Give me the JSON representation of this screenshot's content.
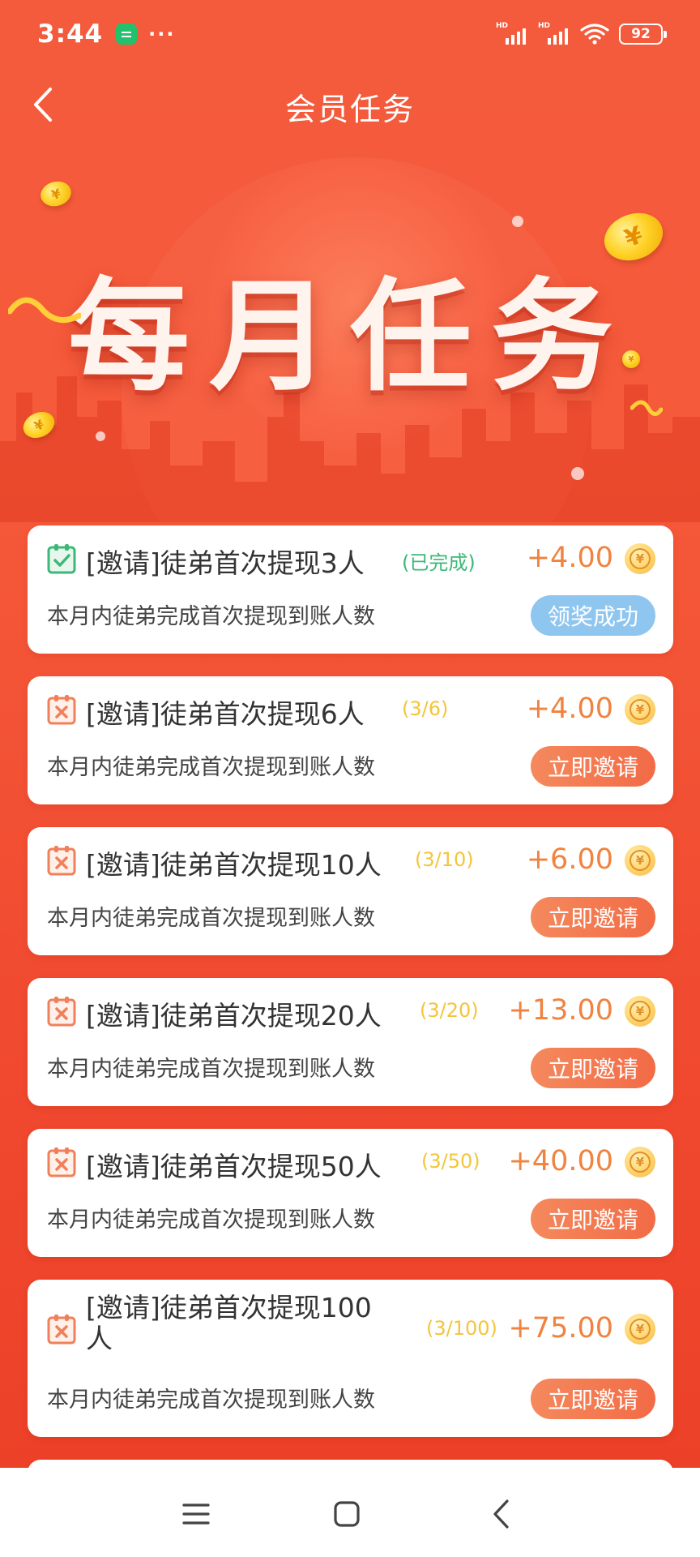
{
  "status_bar": {
    "time": "3:44",
    "battery": "92",
    "signal_label_1": "HD",
    "signal_label_2": "HD"
  },
  "header": {
    "title": "会员任务"
  },
  "banner": {
    "title": "每月任务"
  },
  "tasks": [
    {
      "title": "[邀请]徒弟首次提现3人",
      "progress": "(已完成)",
      "reward": "+4.00",
      "description": "本月内徒弟完成首次提现到账人数",
      "action": "领奖成功",
      "state": "completed"
    },
    {
      "title": "[邀请]徒弟首次提现6人",
      "progress": "(3/6)",
      "reward": "+4.00",
      "description": "本月内徒弟完成首次提现到账人数",
      "action": "立即邀请",
      "state": "pending"
    },
    {
      "title": "[邀请]徒弟首次提现10人",
      "progress": "(3/10)",
      "reward": "+6.00",
      "description": "本月内徒弟完成首次提现到账人数",
      "action": "立即邀请",
      "state": "pending"
    },
    {
      "title": "[邀请]徒弟首次提现20人",
      "progress": "(3/20)",
      "reward": "+13.00",
      "description": "本月内徒弟完成首次提现到账人数",
      "action": "立即邀请",
      "state": "pending"
    },
    {
      "title": "[邀请]徒弟首次提现50人",
      "progress": "(3/50)",
      "reward": "+40.00",
      "description": "本月内徒弟完成首次提现到账人数",
      "action": "立即邀请",
      "state": "pending"
    },
    {
      "title_line1": "[邀请]徒弟首次提现100",
      "title_line2": "人",
      "progress": "(3/100)",
      "reward": "+75.00",
      "description": "本月内徒弟完成首次提现到账人数",
      "action": "立即邀请",
      "state": "pending"
    }
  ],
  "coin_symbol": "¥",
  "colors": {
    "accent": "#f4533b",
    "reward": "#f0833f",
    "progress": "#f3c53a",
    "done": "#3cb878",
    "claimed_button": "#8fc6ef"
  }
}
